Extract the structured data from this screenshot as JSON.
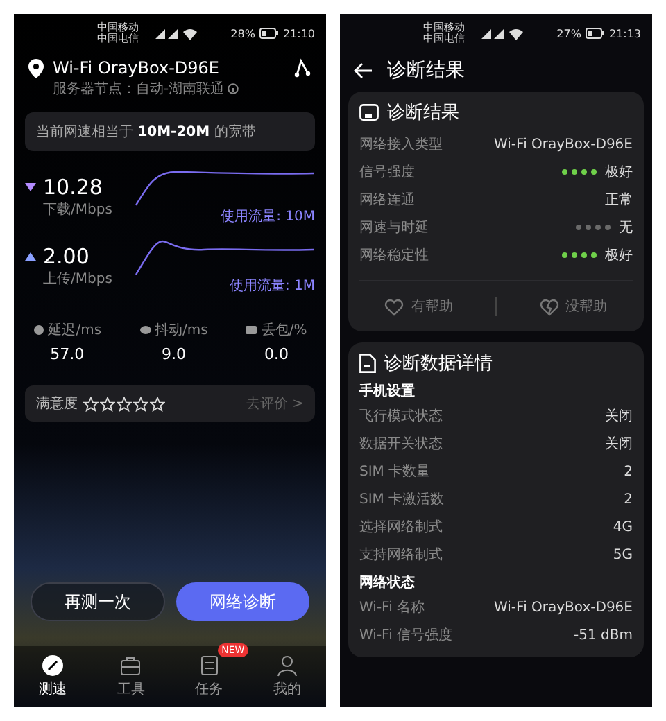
{
  "left_screen": {
    "status_bar": {
      "carriers": [
        "中国移动",
        "中国电信"
      ],
      "battery": "28%",
      "time": "21:10"
    },
    "header": {
      "title": "Wi-Fi OrayBox-D96E",
      "subtitle": "服务器节点：自动-湖南联通"
    },
    "banner": "当前网速相当于 **10M-20M** 的宽带",
    "speeds": [
      {
        "kind": "download",
        "value": "10.28",
        "unit": "下载/Mbps",
        "usage": "使用流量: 10M"
      },
      {
        "kind": "upload",
        "value": "2.00",
        "unit": "上传/Mbps",
        "usage": "使用流量: 1M"
      }
    ],
    "stats": [
      {
        "label": "延迟/ms",
        "value": "57.0"
      },
      {
        "label": "抖动/ms",
        "value": "9.0"
      },
      {
        "label": "丢包/%",
        "value": "0.0"
      }
    ],
    "satisfaction": {
      "label": "满意度",
      "stars": 0,
      "action": "去评价 >"
    },
    "buttons": [
      {
        "label": "再测一次",
        "kind": "secondary"
      },
      {
        "label": "网络诊断",
        "kind": "primary"
      }
    ],
    "tab_bar": [
      {
        "label": "测速",
        "selected": true
      },
      {
        "label": "工具",
        "selected": false
      },
      {
        "label": "任务",
        "selected": false,
        "badge": "NEW"
      },
      {
        "label": "我的",
        "selected": false
      }
    ]
  },
  "right_screen": {
    "status_bar": {
      "carriers": [
        "中国移动",
        "中国电信"
      ],
      "battery": "27%",
      "time": "21:13"
    },
    "title": "诊断结果",
    "result_card": {
      "title": "诊断结果",
      "rows": [
        {
          "kind": "text",
          "label": "网络接入类型",
          "value": "Wi-Fi OrayBox-D96E"
        },
        {
          "kind": "dots",
          "label": "信号强度",
          "value": "极好",
          "color": "#6fd04a"
        },
        {
          "kind": "text",
          "label": "网络连通",
          "value": "正常"
        },
        {
          "kind": "dots",
          "label": "网速与时延",
          "value": "无",
          "color": "#6a6a6a"
        },
        {
          "kind": "dots",
          "label": "网络稳定性",
          "value": "极好",
          "color": "#6fd04a"
        }
      ],
      "feedback": [
        {
          "label": "有帮助"
        },
        {
          "label": "没帮助"
        }
      ]
    },
    "details_card": {
      "title": "诊断数据详情",
      "sections": [
        {
          "heading": "手机设置",
          "rows": [
            {
              "label": "飞行模式状态",
              "value": "关闭"
            },
            {
              "label": "数据开关状态",
              "value": "关闭"
            },
            {
              "label": "SIM 卡数量",
              "value": "2"
            },
            {
              "label": "SIM 卡激活数",
              "value": "2"
            },
            {
              "label": "选择网络制式",
              "value": "4G"
            },
            {
              "label": "支持网络制式",
              "value": "5G"
            }
          ]
        },
        {
          "heading": "网络状态",
          "rows": [
            {
              "label": "Wi-Fi 名称",
              "value": "Wi-Fi OrayBox-D96E"
            },
            {
              "label": "Wi-Fi 信号强度",
              "value": "-51 dBm"
            }
          ]
        }
      ]
    }
  }
}
